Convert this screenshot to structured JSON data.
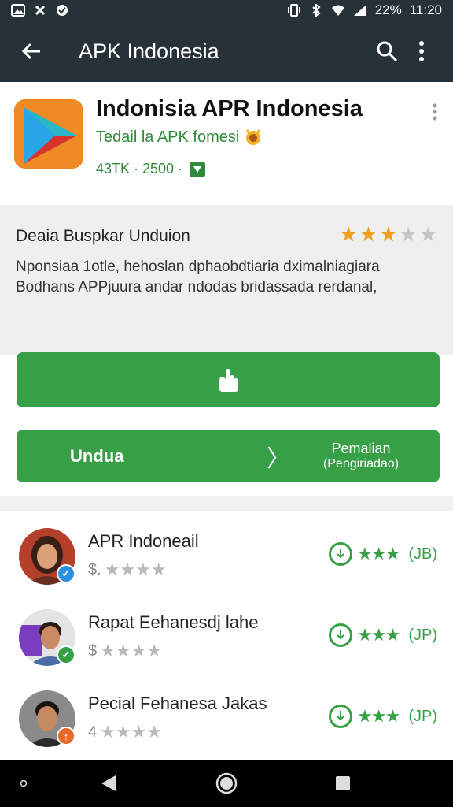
{
  "status_bar": {
    "battery": "22%",
    "time": "11:20"
  },
  "app_bar": {
    "title": "APK Indonesia"
  },
  "app": {
    "name": "Indonisia APR Indonesia",
    "subtitle": "Tedail la APK fomesi",
    "meta": "43TK · 2500 ·"
  },
  "description": {
    "title": "Deaia Buspkar Unduion",
    "rating_filled": 3,
    "rating_total": 5,
    "text": "Nponsiaa 1otle, hehoslan dphaobdtiaria dximalniagiara Bodhans APPjuura andar ndodas bridassada rerdanal,"
  },
  "buttons": {
    "primary_icon": "hand-icon",
    "split_left": "Undua",
    "split_mid": "〉",
    "split_right_1": "Pemalian",
    "split_right_2": "(Pengiriadao)"
  },
  "list": [
    {
      "name": "APR Indoneail",
      "rating_prefix": "$.",
      "badge": "✓",
      "badge_color": "#2d8fe0",
      "count": "(JB)"
    },
    {
      "name": "Rapat Eehanesdj lahe",
      "rating_prefix": "$",
      "badge": "✓",
      "badge_color": "#37a047",
      "count": "(JP)"
    },
    {
      "name": "Pecial Fehanesa Jakas",
      "rating_prefix": "4",
      "badge": "↑",
      "badge_color": "#e86a2a",
      "count": "(JP)"
    }
  ],
  "colors": {
    "appbar": "#263238",
    "accent_green": "#37a047",
    "star_orange": "#f0a020"
  }
}
